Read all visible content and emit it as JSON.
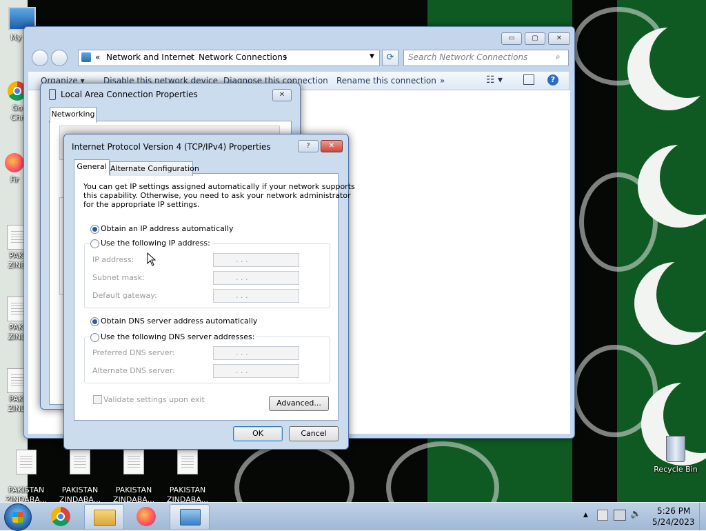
{
  "desktop": {
    "icons": [
      {
        "label": "My Co"
      },
      {
        "label": "Go"
      },
      {
        "label": "Chr"
      },
      {
        "label": "Fir"
      },
      {
        "label": "PAKI"
      },
      {
        "label": "ZIND"
      },
      {
        "label": "PAKI"
      },
      {
        "label": "ZIND"
      },
      {
        "label": "PAKI"
      },
      {
        "label": "ZIND"
      },
      {
        "label": "PAKISTAN\nZINDABA..."
      },
      {
        "label": "PAKISTAN\nZINDABA..."
      },
      {
        "label": "PAKISTAN\nZINDABA..."
      },
      {
        "label": "PAKISTAN\nZINDABA..."
      },
      {
        "label": "Recycle Bin"
      }
    ]
  },
  "explorer": {
    "breadcrumb": {
      "overflow": "«",
      "item1": "Network and Internet",
      "item2": "Network Connections",
      "sep": "›"
    },
    "search_placeholder": "Search Network Connections",
    "toolbar": {
      "organize": "Organize",
      "disable": "Disable this network device",
      "diagnose": "Diagnose this connection",
      "rename": "Rename this connection",
      "more": "»"
    },
    "caption": {
      "minimize": "▭",
      "maximize": "▢",
      "close": "✕"
    }
  },
  "lac_dialog": {
    "title": "Local Area Connection Properties",
    "tab": "Networking",
    "close": "✕"
  },
  "ipv4_dialog": {
    "title": "Internet Protocol Version 4 (TCP/IPv4) Properties",
    "help": "?",
    "close": "✕",
    "tabs": {
      "general": "General",
      "alternate": "Alternate Configuration"
    },
    "intro_1": "You can get IP settings assigned automatically if your network supports",
    "intro_2": "this capability. Otherwise, you need to ask your network administrator",
    "intro_3": "for the appropriate IP settings.",
    "ip_auto": "Obtain an IP address automatically",
    "ip_manual": "Use the following IP address:",
    "ip_address": "IP address:",
    "subnet_mask": "Subnet mask:",
    "default_gateway": "Default gateway:",
    "dns_auto": "Obtain DNS server address automatically",
    "dns_manual": "Use the following DNS server addresses:",
    "preferred_dns": "Preferred DNS server:",
    "alternate_dns": "Alternate DNS server:",
    "ip_dots": ".     .     .",
    "validate": "Validate settings upon exit",
    "advanced": "Advanced...",
    "ok": "OK",
    "cancel": "Cancel"
  },
  "taskbar": {
    "time": "5:26 PM",
    "date": "5/24/2023",
    "tray_arrow": "▲"
  },
  "colors": {
    "flag_green": "#0f5a22",
    "dialog_frame": "#cbdcef",
    "close_red": "#c9463d"
  }
}
